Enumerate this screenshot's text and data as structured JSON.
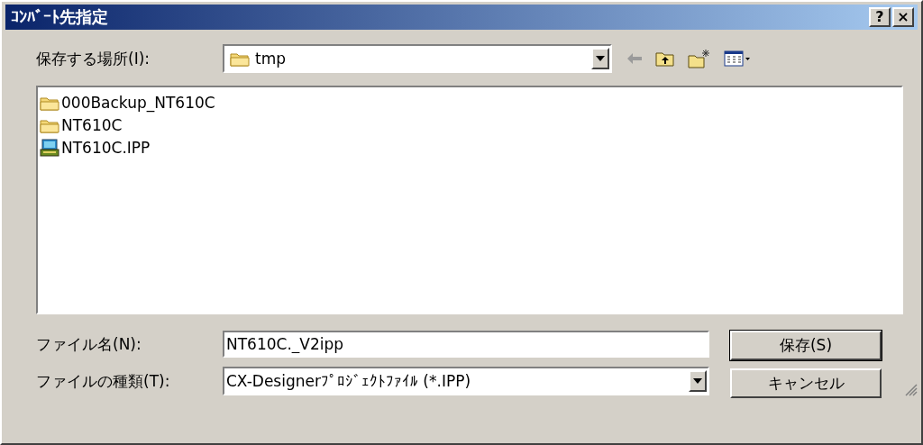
{
  "window": {
    "title": "ｺﾝﾊﾞｰﾄ先指定",
    "help_button": "?",
    "close_button": "×"
  },
  "location": {
    "label": "保存する場所(I):",
    "value": "tmp"
  },
  "files": [
    {
      "kind": "folder",
      "name": "000Backup_NT610C"
    },
    {
      "kind": "folder",
      "name": "NT610C"
    },
    {
      "kind": "project",
      "name": "NT610C.IPP"
    }
  ],
  "file_name": {
    "label": "ファイル名(N):",
    "value": "NT610C._V2ipp"
  },
  "file_type": {
    "label": "ファイルの種類(T):",
    "value": "CX-Designerﾌﾟﾛｼﾞｪｸﾄﾌｧｲﾙ (*.IPP)"
  },
  "buttons": [
    "保存(S)",
    "キャンセル"
  ]
}
